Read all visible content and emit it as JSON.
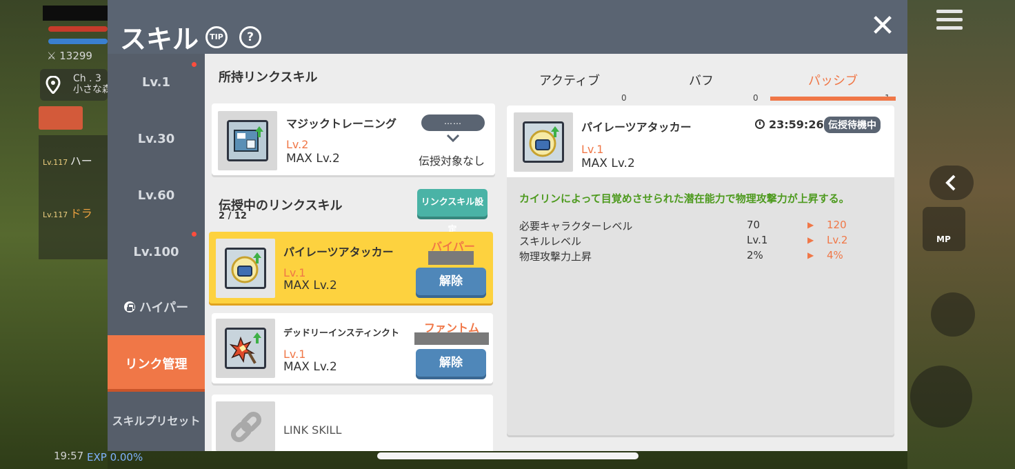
{
  "background": {
    "cp": "13299",
    "channel_line1": "Ch . 3",
    "channel_line2": "小さな森",
    "party_row1_level": "Lv.117",
    "party_row1_name": "ハー",
    "party_row2_level": "Lv.117",
    "party_row2_name": "ドラ",
    "clock": "19:57",
    "exp": "EXP 0.00%",
    "mp_label": "MP"
  },
  "header": {
    "title": "スキル",
    "tip_label": "TIP",
    "help_label": "?",
    "close_label": "✕"
  },
  "sidebar": {
    "items": [
      {
        "label": "Lv.1",
        "dot": true
      },
      {
        "label": "Lv.30",
        "dot": false
      },
      {
        "label": "Lv.60",
        "dot": false
      },
      {
        "label": "Lv.100",
        "dot": true
      },
      {
        "label": "ハイパー",
        "locked": true
      },
      {
        "label": "リンク管理",
        "active": true
      },
      {
        "label": "スキルプリセット"
      }
    ]
  },
  "owned": {
    "section_title": "所持リンクスキル",
    "skill_name": "マジックトレーニング",
    "level": "Lv.2",
    "max": "MAX Lv.2",
    "pill_text": "……",
    "status": "伝授対象なし"
  },
  "teaching": {
    "section_title": "伝授中のリンクスキル",
    "count": "2 / 12",
    "settings_button": "リンクスキル設定",
    "cards": [
      {
        "name": "パイレーツアタッカー",
        "level": "Lv.1",
        "max": "MAX Lv.2",
        "class": "バイパー",
        "action": "解除"
      },
      {
        "name": "デッドリーインスティンクト",
        "level": "Lv.1",
        "max": "MAX Lv.2",
        "class": "ファントム",
        "action": "解除"
      }
    ],
    "empty_slot": "LINK SKILL"
  },
  "tabs": [
    {
      "label": "アクティブ",
      "count": "0"
    },
    {
      "label": "バフ",
      "count": "0"
    },
    {
      "label": "パッシブ",
      "count": "1",
      "active": true
    }
  ],
  "detail": {
    "skill_name": "パイレーツアタッカー",
    "level": "Lv.1",
    "max": "MAX Lv.2",
    "timer": "23:59:26",
    "badge": "伝授待機中",
    "description": "カイリンによって目覚めさせられた潜在能力で物理攻撃力が上昇する。",
    "stats": [
      {
        "label": "必要キャラクターレベル",
        "current": "70",
        "next": "120"
      },
      {
        "label": "スキルレベル",
        "current": "Lv.1",
        "next": "Lv.2"
      },
      {
        "label": "物理攻撃力上昇",
        "current": "2%",
        "next": "4%"
      }
    ]
  },
  "colors": {
    "accent": "#f07747",
    "header": "#5a6472",
    "button_blue": "#4f87b9",
    "button_teal": "#4ab3a6",
    "highlight_card": "#fdd23f",
    "description_green": "#4d9a1e"
  }
}
